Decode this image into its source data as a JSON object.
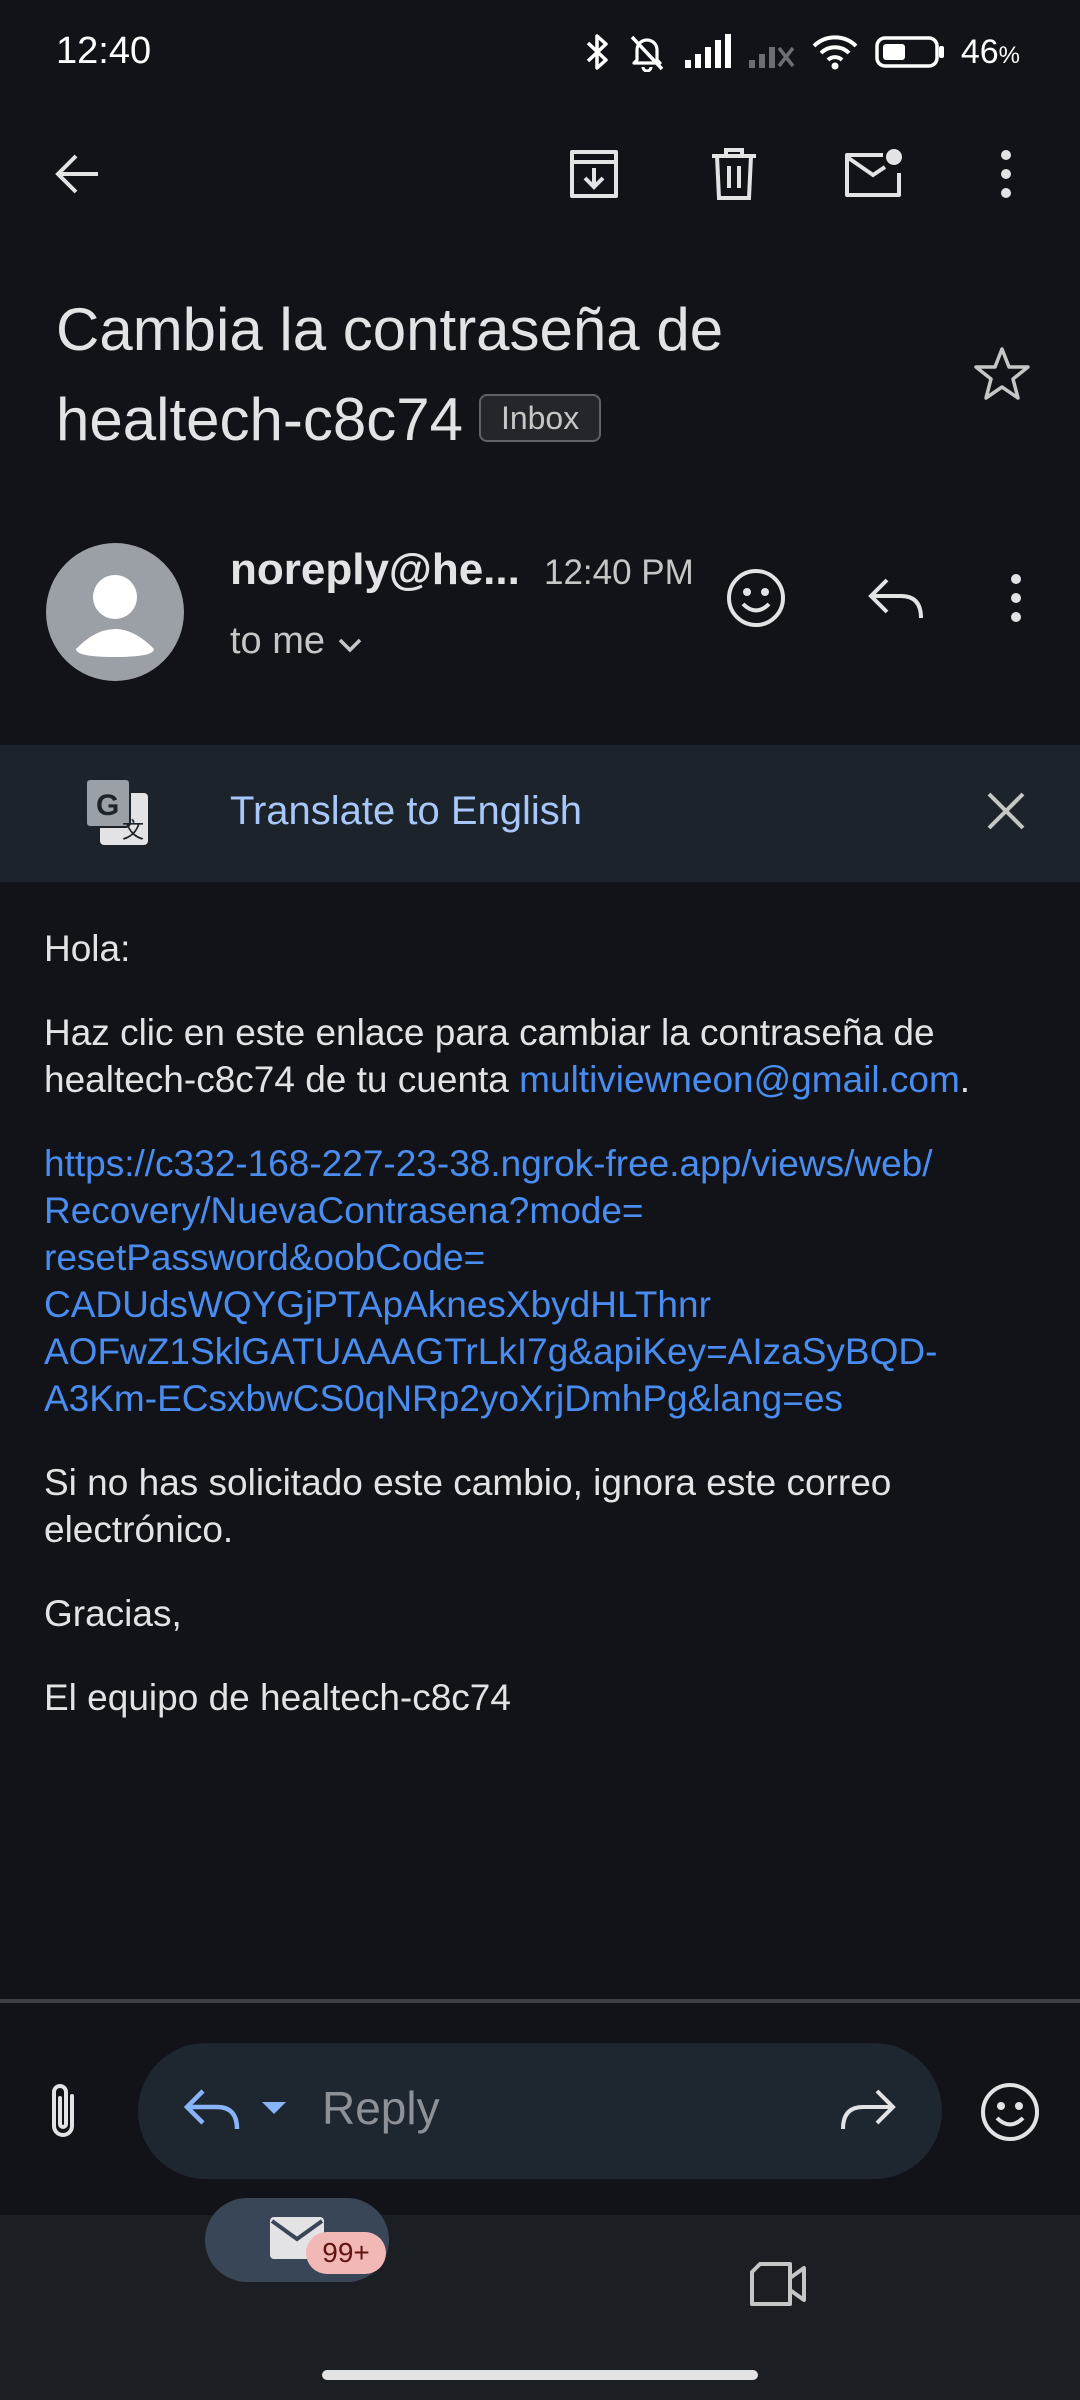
{
  "status_bar": {
    "time": "12:40",
    "battery_percent": "46",
    "battery_suffix": "%",
    "battery_level": 0.46,
    "icons": [
      "bluetooth-icon",
      "bell-off-icon",
      "signal-icon",
      "signal-no-service-icon",
      "wifi-icon",
      "battery-icon"
    ]
  },
  "app_bar": {
    "icons": [
      "back-arrow-icon",
      "archive-icon",
      "delete-icon",
      "mark-unread-icon",
      "more-vert-icon"
    ]
  },
  "email": {
    "subject": "Cambia la contraseña de healtech-c8c74",
    "label": "Inbox",
    "sender_name": "noreply@he...",
    "time": "12:40 PM",
    "to": "to me"
  },
  "translate": {
    "text": "Translate to English"
  },
  "body": {
    "greeting": "Hola:",
    "line1": "Haz clic en este enlace para cambiar la contraseña de healtech-c8c74 de tu cuenta ",
    "email_link": "multiviewneon@gmail.com",
    "line1_end": ".",
    "url_lines": [
      "https://c332-168-227-23-38.ngrok-free.app/views/web/",
      "Recovery/NuevaContrasena?mode=",
      "resetPassword&oobCode=",
      "CADUdsWQYGjPTApAknesXbydHLThnr",
      "AOFwZ1SklGATUAAAGTrLkI7g&apiKey=AIzaSyBQD-",
      "A3Km-ECsxbwCS0qNRp2yoXrjDmhPg&lang=es"
    ],
    "ignore": "Si no has solicitado este cambio, ignora este correo electrónico.",
    "thanks": "Gracias,",
    "signature": "El equipo de healtech-c8c74"
  },
  "composer": {
    "placeholder": "Reply"
  },
  "bottom_nav": {
    "mail_badge": "99+"
  },
  "colors": {
    "background": "#111318",
    "link": "#4a8df0",
    "translate_text": "#a8c7fa",
    "badge": "#f2b8b5"
  }
}
